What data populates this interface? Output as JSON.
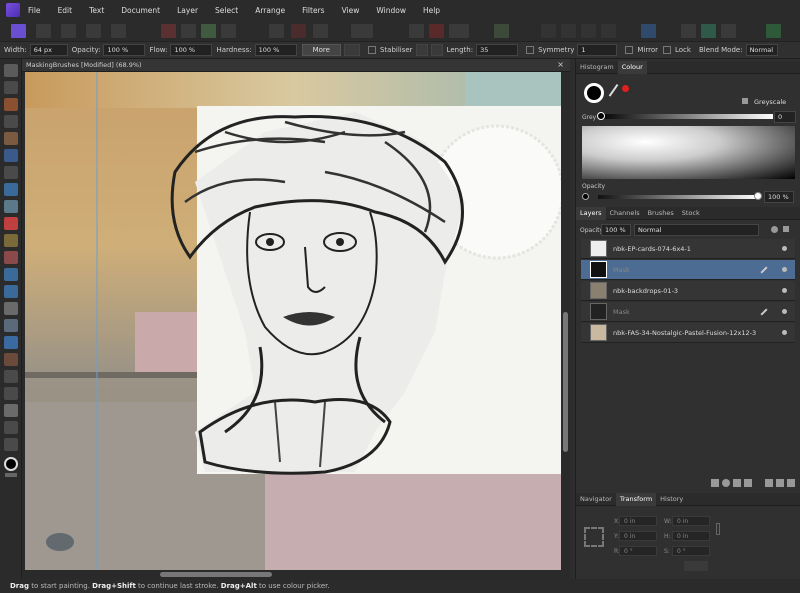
{
  "menu": [
    "File",
    "Edit",
    "Text",
    "Document",
    "Layer",
    "Select",
    "Arrange",
    "Filters",
    "View",
    "Window",
    "Help"
  ],
  "context": {
    "width_label": "Width:",
    "width_value": "64 px",
    "opacity_label": "Opacity:",
    "opacity_value": "100 %",
    "flow_label": "Flow:",
    "flow_value": "100 %",
    "hardness_label": "Hardness:",
    "hardness_value": "100 %",
    "more_label": "More",
    "stabiliser_label": "Stabiliser",
    "length_label": "Length:",
    "length_value": "35",
    "symmetry_label": "Symmetry",
    "symmetry_value": "1",
    "mirror_label": "Mirror",
    "lock_label": "Lock",
    "blend_label": "Blend Mode:",
    "blend_value": "Normal"
  },
  "document": {
    "tab_title": "MaskingBrushes [Modified] (68.9%)",
    "close": "×"
  },
  "status": {
    "part1": "Drag",
    "part2": " to start painting. ",
    "part3": "Drag+Shift",
    "part4": " to continue last stroke. ",
    "part5": "Drag+Alt",
    "part6": " to use colour picker."
  },
  "colour_panel": {
    "tabs": [
      "Histogram",
      "Colour"
    ],
    "model": "Greyscale",
    "grey_label": "Grey",
    "grey_value": "0",
    "opacity_label": "Opacity",
    "opacity_value": "100 %"
  },
  "layers_panel": {
    "tabs": [
      "Layers",
      "Channels",
      "Brushes",
      "Stock"
    ],
    "opacity_label": "Opacity:",
    "opacity_value": "100 %",
    "blend": "Normal",
    "layers": [
      {
        "name": "nbk-EP-cards-074-6x4-1",
        "muted": false,
        "selected": false
      },
      {
        "name": "Mask",
        "muted": true,
        "selected": true
      },
      {
        "name": "nbk-backdrops-01-3",
        "muted": false,
        "selected": false
      },
      {
        "name": "Mask",
        "muted": true,
        "selected": false
      },
      {
        "name": "nbk-FAS-34-Nostalgic-Pastel-Fusion-12x12-3",
        "muted": false,
        "selected": false
      }
    ]
  },
  "transform_panel": {
    "tabs": [
      "Navigator",
      "Transform",
      "History"
    ],
    "x_label": "X:",
    "x_value": "0 in",
    "y_label": "Y:",
    "y_value": "0 in",
    "w_label": "W:",
    "w_value": "0 in",
    "h_label": "H:",
    "h_value": "0 in",
    "r_label": "R:",
    "r_value": "0 °",
    "s_label": "S:",
    "s_value": "0 °"
  },
  "colors": {
    "accent": "#4d6c93",
    "primary": "#000000",
    "secondary": "#ffffff",
    "alert": "#e02020"
  }
}
